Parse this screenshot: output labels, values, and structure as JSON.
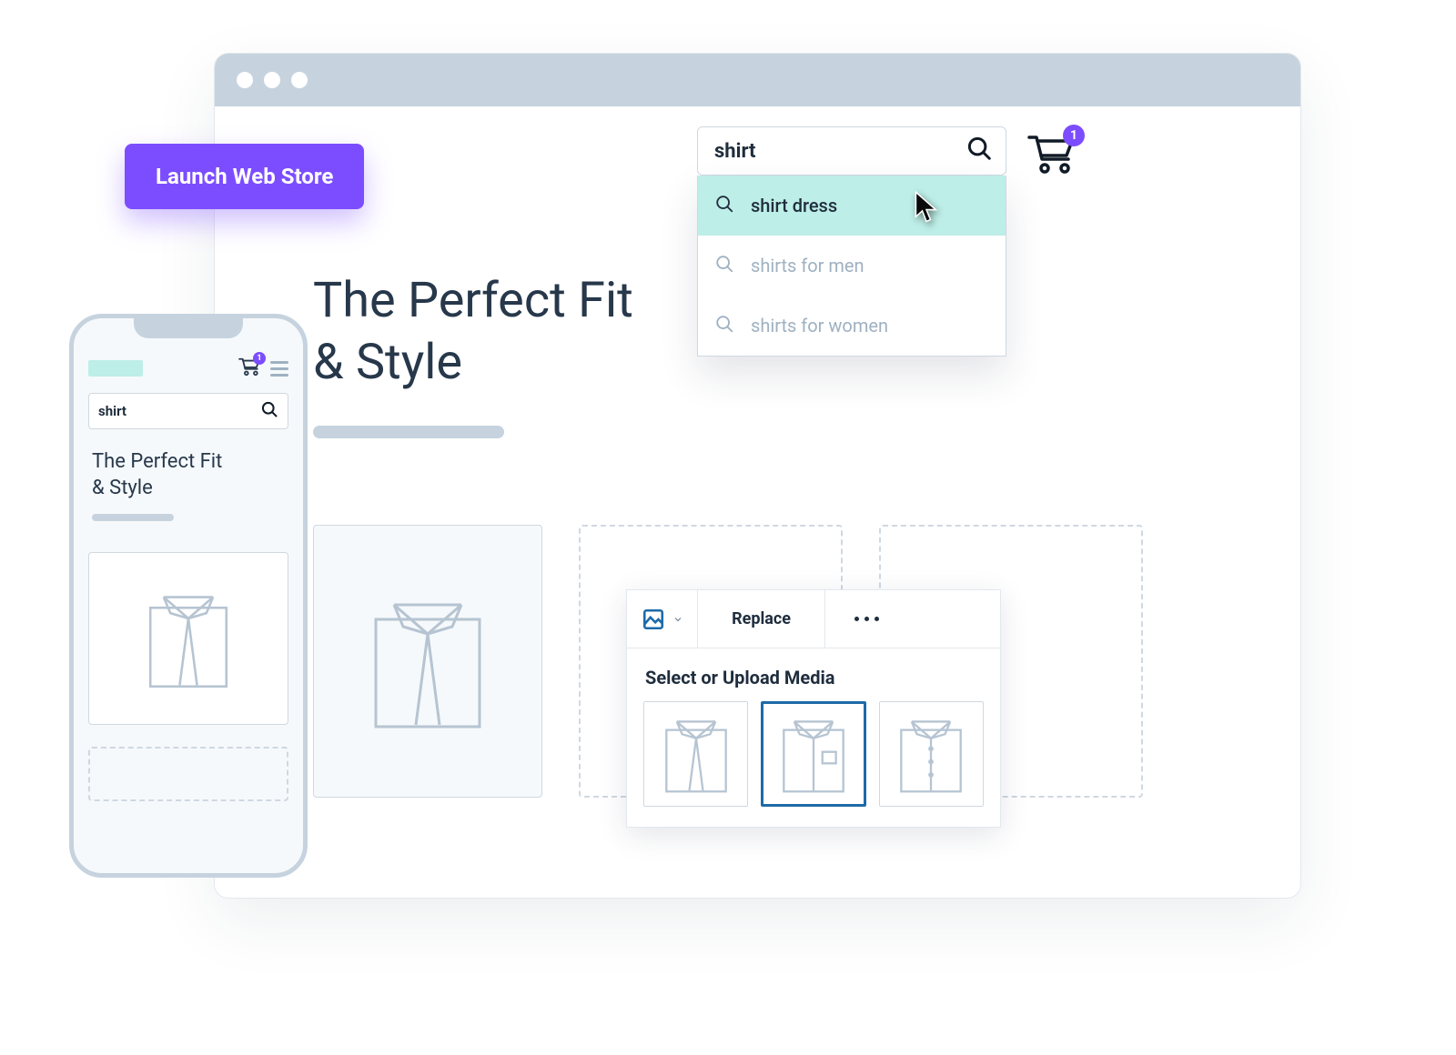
{
  "launch_button": {
    "label": "Launch Web Store"
  },
  "browser": {
    "search": {
      "value": "shirt",
      "suggestions": [
        {
          "label": "shirt dress",
          "active": true
        },
        {
          "label": "shirts for men",
          "active": false
        },
        {
          "label": "shirts for women",
          "active": false
        }
      ]
    },
    "cart": {
      "count": "1"
    },
    "hero": {
      "title_line1": "The Perfect Fit",
      "title_line2": "& Style"
    }
  },
  "phone": {
    "search_value": "shirt",
    "cart_count": "1",
    "hero": {
      "title_line1": "The Perfect Fit",
      "title_line2": "& Style"
    }
  },
  "media_panel": {
    "replace_label": "Replace",
    "title": "Select or Upload Media",
    "thumbs": [
      {
        "id": "shirt-tie",
        "selected": false
      },
      {
        "id": "shirt-pocket",
        "selected": true
      },
      {
        "id": "shirt-buttons",
        "selected": false
      }
    ]
  },
  "colors": {
    "accent_purple": "#7c4dff",
    "accent_teal": "#bdeee7",
    "ink": "#1f2d3d",
    "muted": "#9fb1c1",
    "line": "#cfd8e1"
  }
}
